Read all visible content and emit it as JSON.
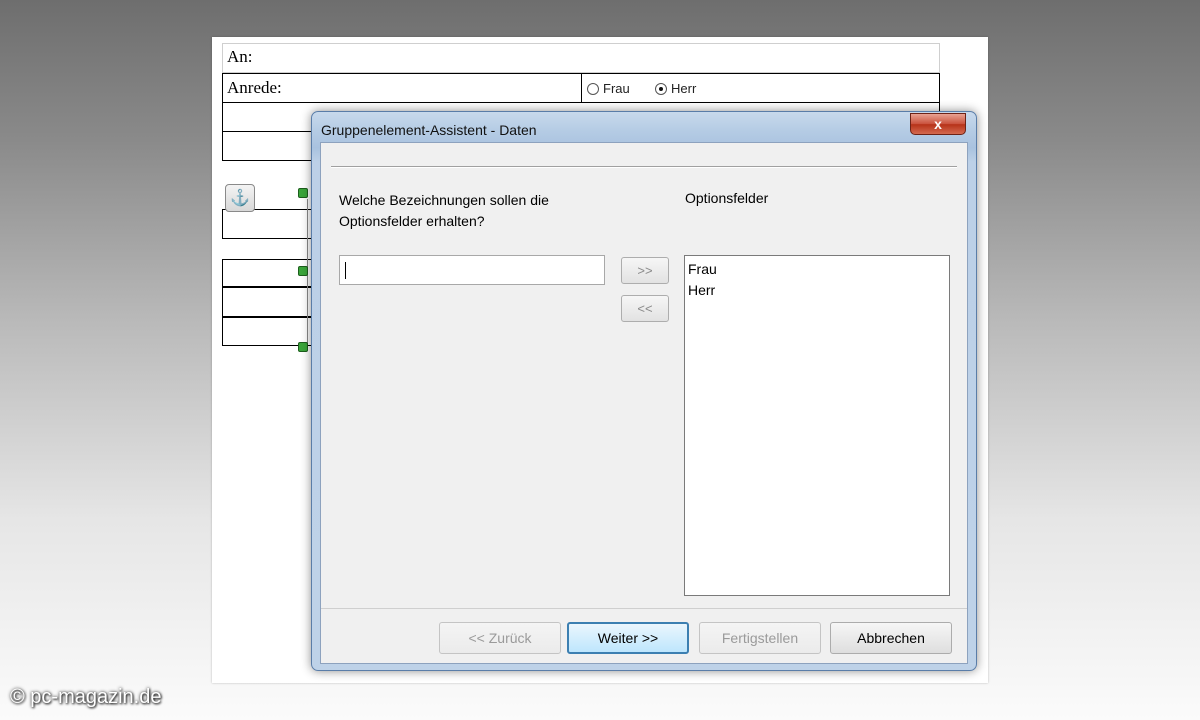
{
  "document": {
    "an_label": "An:",
    "anrede_label": "Anrede:",
    "radio_options": [
      {
        "label": "Frau",
        "checked": false
      },
      {
        "label": "Herr",
        "checked": true
      }
    ],
    "anchor_icon": "anchor-icon"
  },
  "dialog": {
    "title": "Gruppenelement-Assistent - Daten",
    "close_label": "x",
    "question": "Welche Bezeichnungen sollen die Optionsfelder erhalten?",
    "input_value": "",
    "add_button": ">>",
    "remove_button": "<<",
    "list_label": "Optionsfelder",
    "list_items": [
      "Frau",
      "Herr"
    ],
    "buttons": {
      "back": "<< Zurück",
      "next": "Weiter >>",
      "finish": "Fertigstellen",
      "cancel": "Abbrechen"
    }
  },
  "watermark": "© pc-magazin.de"
}
